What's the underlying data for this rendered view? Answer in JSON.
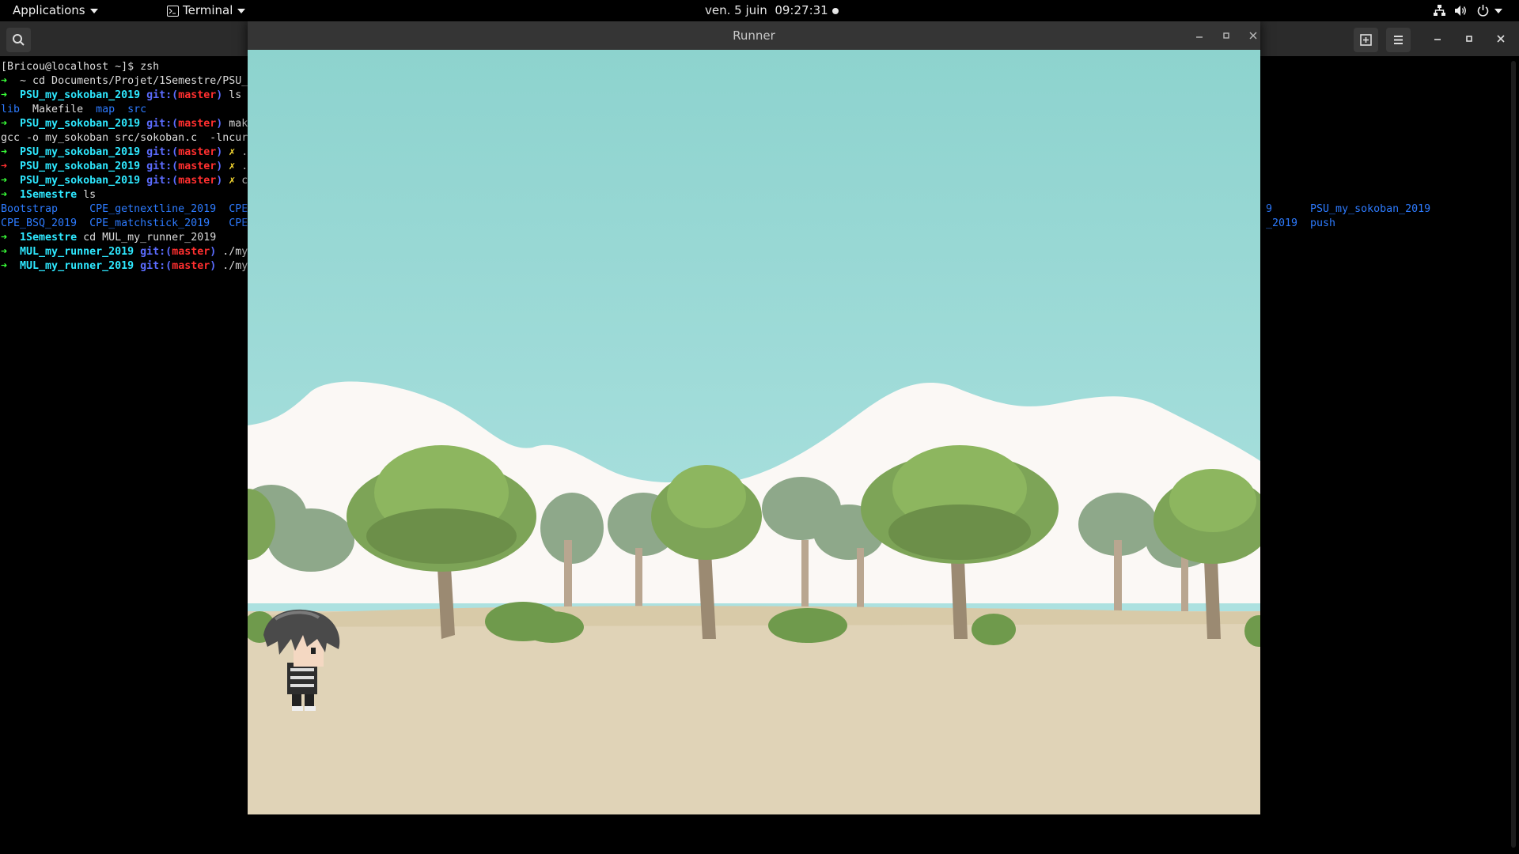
{
  "topbar": {
    "applications_label": "Applications",
    "terminal_label": "Terminal",
    "clock": "ven. 5 juin  09:27:31"
  },
  "runner_window": {
    "title": "Runner",
    "game": {
      "sky_color": "#8fd4cf",
      "ground_color": "#e0d3b7",
      "character": "runner-character"
    }
  },
  "terminal": {
    "lines": [
      [
        {
          "t": "[Bricou@localhost ~]$ zsh",
          "c": ""
        }
      ],
      [
        {
          "t": "➜  ",
          "c": "arrow-g"
        },
        {
          "t": "~ cd Documents/Projet/1Semestre/PSU_",
          "c": ""
        }
      ],
      [
        {
          "t": "➜  ",
          "c": "arrow-g"
        },
        {
          "t": "PSU_my_sokoban_2019",
          "c": "dir"
        },
        {
          "t": " git:(",
          "c": "git"
        },
        {
          "t": "master",
          "c": "branch"
        },
        {
          "t": ")",
          "c": "git"
        },
        {
          "t": " ls",
          "c": ""
        }
      ],
      [
        {
          "t": "lib",
          "c": "lsd"
        },
        {
          "t": "  Makefile  ",
          "c": ""
        },
        {
          "t": "map",
          "c": "lsd"
        },
        {
          "t": "  ",
          "c": ""
        },
        {
          "t": "src",
          "c": "lsd"
        }
      ],
      [
        {
          "t": "➜  ",
          "c": "arrow-g"
        },
        {
          "t": "PSU_my_sokoban_2019",
          "c": "dir"
        },
        {
          "t": " git:(",
          "c": "git"
        },
        {
          "t": "master",
          "c": "branch"
        },
        {
          "t": ")",
          "c": "git"
        },
        {
          "t": " mak",
          "c": ""
        }
      ],
      [
        {
          "t": "gcc -o my_sokoban src/sokoban.c  -lncur",
          "c": ""
        }
      ],
      [
        {
          "t": "➜  ",
          "c": "arrow-g"
        },
        {
          "t": "PSU_my_sokoban_2019",
          "c": "dir"
        },
        {
          "t": " git:(",
          "c": "git"
        },
        {
          "t": "master",
          "c": "branch"
        },
        {
          "t": ")",
          "c": "git"
        },
        {
          "t": " ✗ ",
          "c": "dirty"
        },
        {
          "t": ".",
          "c": ""
        }
      ],
      [
        {
          "t": "➜  ",
          "c": "arrow-r"
        },
        {
          "t": "PSU_my_sokoban_2019",
          "c": "dir"
        },
        {
          "t": " git:(",
          "c": "git"
        },
        {
          "t": "master",
          "c": "branch"
        },
        {
          "t": ")",
          "c": "git"
        },
        {
          "t": " ✗ ",
          "c": "dirty"
        },
        {
          "t": ".",
          "c": ""
        }
      ],
      [
        {
          "t": "➜  ",
          "c": "arrow-g"
        },
        {
          "t": "PSU_my_sokoban_2019",
          "c": "dir"
        },
        {
          "t": " git:(",
          "c": "git"
        },
        {
          "t": "master",
          "c": "branch"
        },
        {
          "t": ")",
          "c": "git"
        },
        {
          "t": " ✗ ",
          "c": "dirty"
        },
        {
          "t": "c",
          "c": ""
        }
      ],
      [
        {
          "t": "➜  ",
          "c": "arrow-g"
        },
        {
          "t": "1Semestre",
          "c": "dir"
        },
        {
          "t": " ls",
          "c": ""
        }
      ],
      [
        {
          "t": "Bootstrap     CPE_getnextline_2019  CPE",
          "c": "lsd"
        }
      ],
      [
        {
          "t": "CPE_BSQ_2019  CPE_matchstick_2019   CPE",
          "c": "lsd"
        }
      ],
      [
        {
          "t": "➜  ",
          "c": "arrow-g"
        },
        {
          "t": "1Semestre",
          "c": "dir"
        },
        {
          "t": " cd MUL_my_runner_2019",
          "c": ""
        }
      ],
      [
        {
          "t": "➜  ",
          "c": "arrow-g"
        },
        {
          "t": "MUL_my_runner_2019",
          "c": "dir"
        },
        {
          "t": " git:(",
          "c": "git"
        },
        {
          "t": "master",
          "c": "branch"
        },
        {
          "t": ")",
          "c": "git"
        },
        {
          "t": " ./my",
          "c": ""
        }
      ],
      [
        {
          "t": "➜  ",
          "c": "arrow-g"
        },
        {
          "t": "MUL_my_runner_2019",
          "c": "dir"
        },
        {
          "t": " git:(",
          "c": "git"
        },
        {
          "t": "master",
          "c": "branch"
        },
        {
          "t": ")",
          "c": "git"
        },
        {
          "t": " ./my",
          "c": ""
        }
      ]
    ],
    "right_fragments": [
      {
        "line": 10,
        "text": "9      PSU_my_sokoban_2019"
      },
      {
        "line": 11,
        "text": "_2019  push"
      }
    ]
  }
}
